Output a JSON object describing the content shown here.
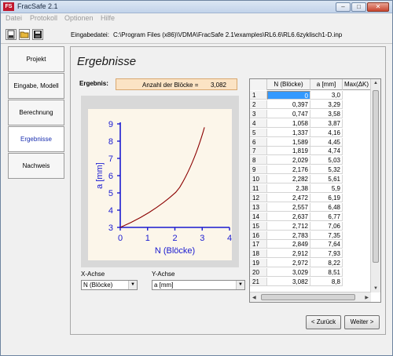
{
  "window": {
    "title": "FracSafe 2.1",
    "icon_text": "FS",
    "min": "–",
    "max": "□",
    "close": "✕"
  },
  "menu": [
    "Datei",
    "Protokoll",
    "Optionen",
    "Hilfe"
  ],
  "toolbar": {
    "icons": [
      "new-file-icon",
      "open-folder-icon",
      "save-icon"
    ],
    "file_label": "Eingabedatei:",
    "file_path": "C:\\Program Files (x86)\\VDMA\\FracSafe 2.1\\examples\\RL6.6\\RL6.6zyklisch1-D.inp"
  },
  "sidebar": {
    "items": [
      "Projekt",
      "Eingabe, Modell",
      "Berechnung",
      "Ergebnisse",
      "Nachweis"
    ],
    "active": "Ergebnisse"
  },
  "main": {
    "heading": "Ergebnisse",
    "result_label": "Ergebnis:",
    "result_text": "Anzahl der Blöcke =",
    "result_value": "3,082",
    "x_axis_label": "X-Achse",
    "x_axis_value": "N (Blöcke)",
    "y_axis_label": "Y-Achse",
    "y_axis_value": "a [mm]",
    "back_button": "< Zurück",
    "next_button": "Weiter >"
  },
  "table": {
    "columns": [
      "N (Blöcke)",
      "a [mm]",
      "Max(ΔK)"
    ],
    "rows": [
      [
        "1",
        "0",
        "3,0"
      ],
      [
        "2",
        "0,397",
        "3,29"
      ],
      [
        "3",
        "0,747",
        "3,58"
      ],
      [
        "4",
        "1,058",
        "3,87"
      ],
      [
        "5",
        "1,337",
        "4,16"
      ],
      [
        "6",
        "1,589",
        "4,45"
      ],
      [
        "7",
        "1,819",
        "4,74"
      ],
      [
        "8",
        "2,029",
        "5,03"
      ],
      [
        "9",
        "2,176",
        "5,32"
      ],
      [
        "10",
        "2,282",
        "5,61"
      ],
      [
        "11",
        "2,38",
        "5,9"
      ],
      [
        "12",
        "2,472",
        "6,19"
      ],
      [
        "13",
        "2,557",
        "6,48"
      ],
      [
        "14",
        "2,637",
        "6,77"
      ],
      [
        "15",
        "2,712",
        "7,06"
      ],
      [
        "16",
        "2,783",
        "7,35"
      ],
      [
        "17",
        "2,849",
        "7,64"
      ],
      [
        "18",
        "2,912",
        "7,93"
      ],
      [
        "19",
        "2,972",
        "8,22"
      ],
      [
        "20",
        "3,029",
        "8,51"
      ],
      [
        "21",
        "3,082",
        "8,8"
      ]
    ]
  },
  "chart_data": {
    "type": "line",
    "xlabel": "N (Blöcke)",
    "ylabel": "a [mm]",
    "xlim": [
      0,
      4
    ],
    "ylim": [
      3,
      9
    ],
    "xticks": [
      "0",
      "1",
      "2",
      "3",
      "4"
    ],
    "yticks": [
      "3",
      "4",
      "5",
      "6",
      "7",
      "8",
      "9"
    ],
    "line_color": "#8b0000",
    "axis_color": "#1a1ad0",
    "x": [
      0,
      0.397,
      0.747,
      1.058,
      1.337,
      1.589,
      1.819,
      2.029,
      2.176,
      2.282,
      2.38,
      2.472,
      2.557,
      2.637,
      2.712,
      2.783,
      2.849,
      2.912,
      2.972,
      3.029,
      3.082
    ],
    "y": [
      3.0,
      3.29,
      3.58,
      3.87,
      4.16,
      4.45,
      4.74,
      5.03,
      5.32,
      5.61,
      5.9,
      6.19,
      6.48,
      6.77,
      7.06,
      7.35,
      7.64,
      7.93,
      8.22,
      8.51,
      8.8
    ]
  }
}
